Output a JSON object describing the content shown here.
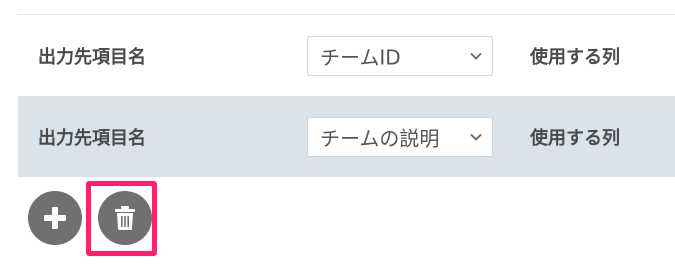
{
  "rows": [
    {
      "label": "出力先項目名",
      "select_value": "チームID",
      "column_label": "使用する列"
    },
    {
      "label": "出力先項目名",
      "select_value": "チームの説明",
      "column_label": "使用する列"
    }
  ],
  "actions": {
    "add_icon": "plus-icon",
    "delete_icon": "trash-icon",
    "highlight_color": "#ff1f6d"
  },
  "colors": {
    "row_alt_bg": "#dae3ea",
    "button_bg": "#707070",
    "text": "#4a4a4a"
  }
}
